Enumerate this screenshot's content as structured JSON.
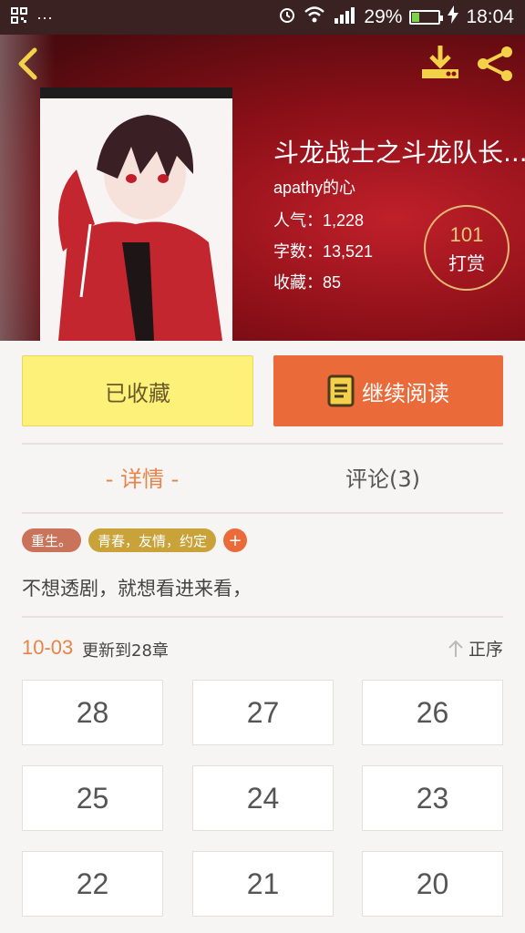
{
  "status_bar": {
    "dots": "···",
    "battery": "29%",
    "time": "18:04",
    "battery_level": 0.29
  },
  "book": {
    "title": "斗龙战士之斗龙队长...",
    "author": "apathy的心",
    "popularity": "人气：1,228",
    "word_count": "字数：13,521",
    "favorites": "收藏：85"
  },
  "reward": {
    "count": "101",
    "label": "打赏"
  },
  "actions": {
    "favorited_label": "已收藏",
    "continue_label": "继续阅读"
  },
  "tabs": {
    "detail": "- 详情 -",
    "comments": "评论(3)"
  },
  "tags": [
    {
      "label": "重生。",
      "color": "#c9735a"
    },
    {
      "label": "青春，友情，约定",
      "color": "#c9a23a"
    }
  ],
  "tag_add": "+",
  "summary": "不想透剧，就想看进来看，",
  "update": {
    "date": "10-03",
    "text": "更新到28章",
    "sort_label": "正序"
  },
  "chapters": [
    "28",
    "27",
    "26",
    "25",
    "24",
    "23",
    "22",
    "21",
    "20"
  ],
  "colors": {
    "accent": "#ea6a3a",
    "favorite_bg": "#fdf17a",
    "header": "#8a0f17"
  }
}
